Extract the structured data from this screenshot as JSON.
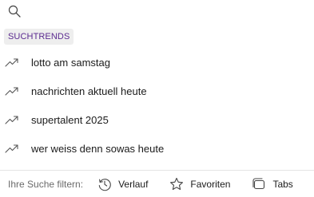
{
  "search": {
    "icon": "search-icon"
  },
  "section": {
    "title": "SUCHTRENDS",
    "title_color": "#5b2a90"
  },
  "trends": [
    {
      "label": "lotto am samstag",
      "icon": "trending-up-icon"
    },
    {
      "label": "nachrichten aktuell heute",
      "icon": "trending-up-icon"
    },
    {
      "label": "supertalent 2025",
      "icon": "trending-up-icon"
    },
    {
      "label": "wer weiss denn sowas heute",
      "icon": "trending-up-icon"
    }
  ],
  "filter": {
    "label": "Ihre Suche filtern:",
    "options": [
      {
        "label": "Verlauf",
        "icon": "history-icon"
      },
      {
        "label": "Favoriten",
        "icon": "star-icon"
      },
      {
        "label": "Tabs",
        "icon": "tabs-icon"
      }
    ]
  }
}
